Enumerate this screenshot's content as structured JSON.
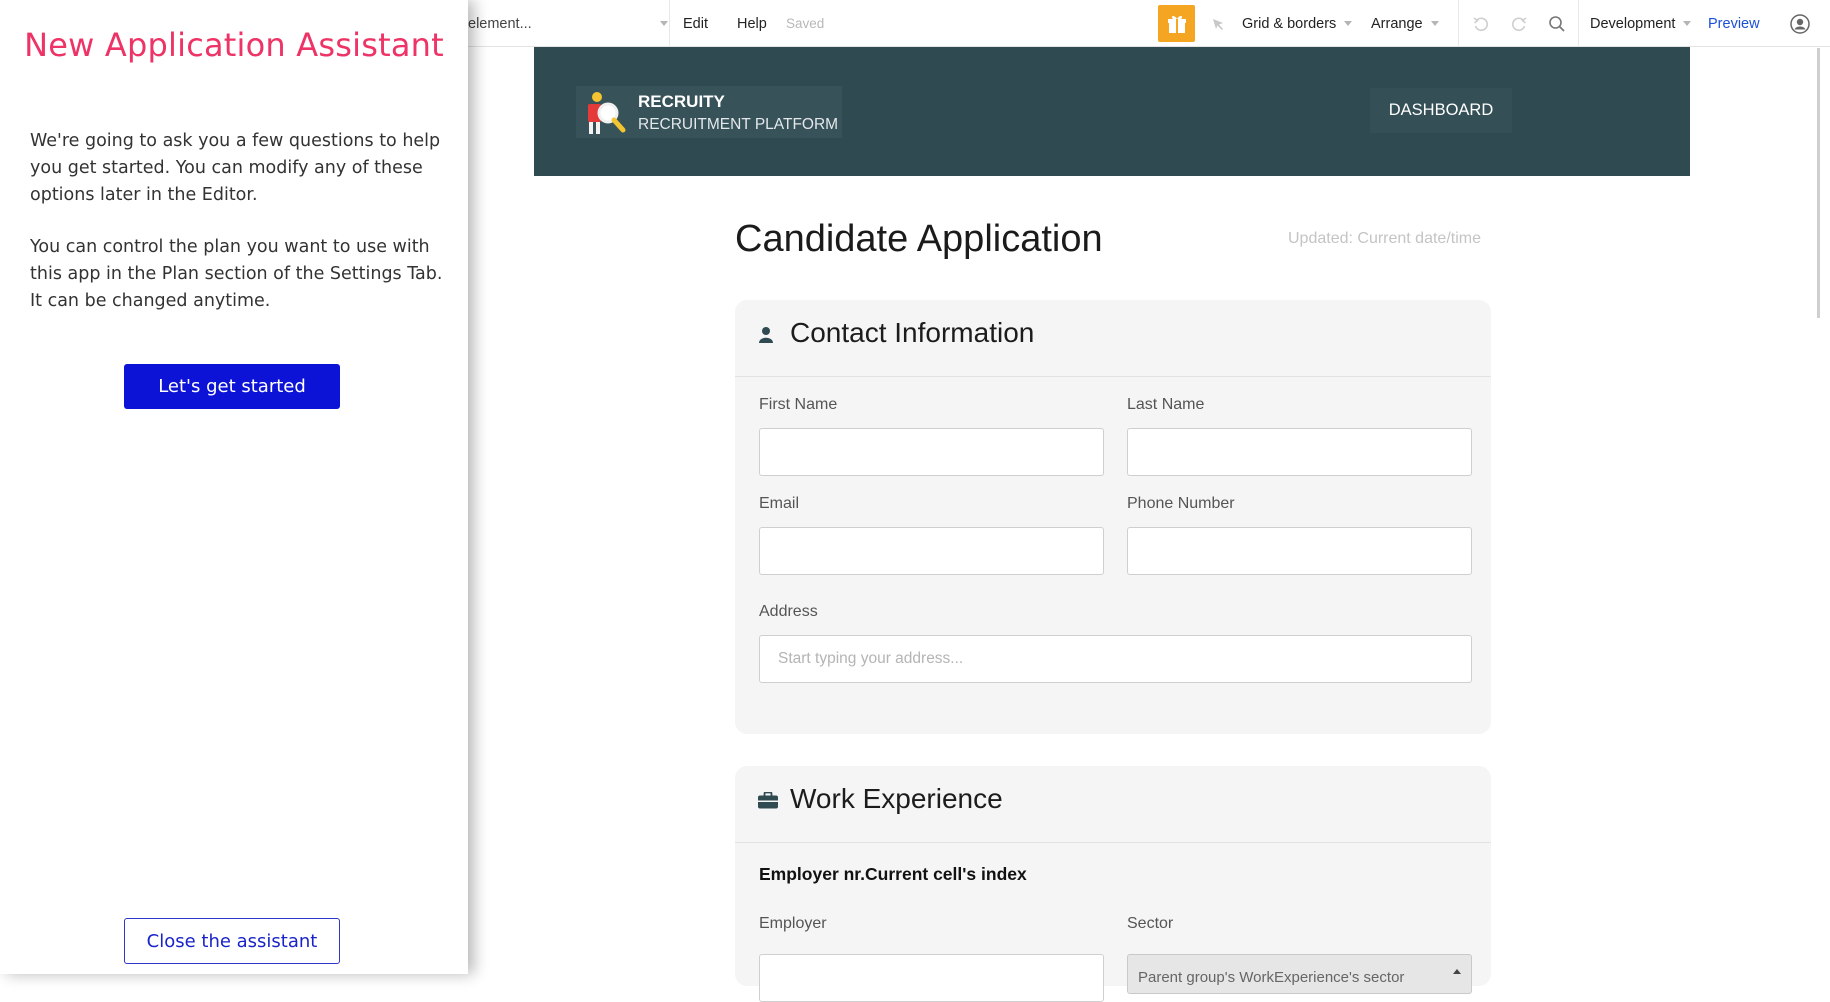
{
  "assistant": {
    "title": "New Application Assistant",
    "paragraph1": "We're going to ask you a few questions to help you get started. You can modify any of these options later in the Editor.",
    "paragraph2": "You can control the plan you want to use with this app in the Plan section of the Settings Tab. It can be changed anytime.",
    "start_label": "Let's get started",
    "close_label": "Close the assistant",
    "title_color": "#ee3366",
    "button_color": "#0d13d6"
  },
  "toolbar": {
    "element_search": "element...",
    "edit": "Edit",
    "help": "Help",
    "saved": "Saved",
    "grid": "Grid & borders",
    "arrange": "Arrange",
    "environment": "Development",
    "preview": "Preview",
    "icons": [
      "gift-icon",
      "pointer-icon",
      "undo-icon",
      "redo-icon",
      "search-icon",
      "user-icon"
    ]
  },
  "app": {
    "brand_name": "RECRUITY",
    "brand_sub": "RECRUITMENT PLATFORM",
    "dashboard": "DASHBOARD",
    "header_color": "#2f4a51",
    "page_title": "Candidate Application",
    "updated": "Updated: Current date/time",
    "contact": {
      "heading": "Contact Information",
      "first_name": "First Name",
      "last_name": "Last Name",
      "email": "Email",
      "phone": "Phone Number",
      "address": "Address",
      "address_placeholder": "Start typing your address..."
    },
    "work": {
      "heading": "Work Experience",
      "employer_heading": "Employer nr.Current cell's index",
      "employer": "Employer",
      "sector": "Sector",
      "sector_value": "Parent group's WorkExperience's sector"
    }
  }
}
